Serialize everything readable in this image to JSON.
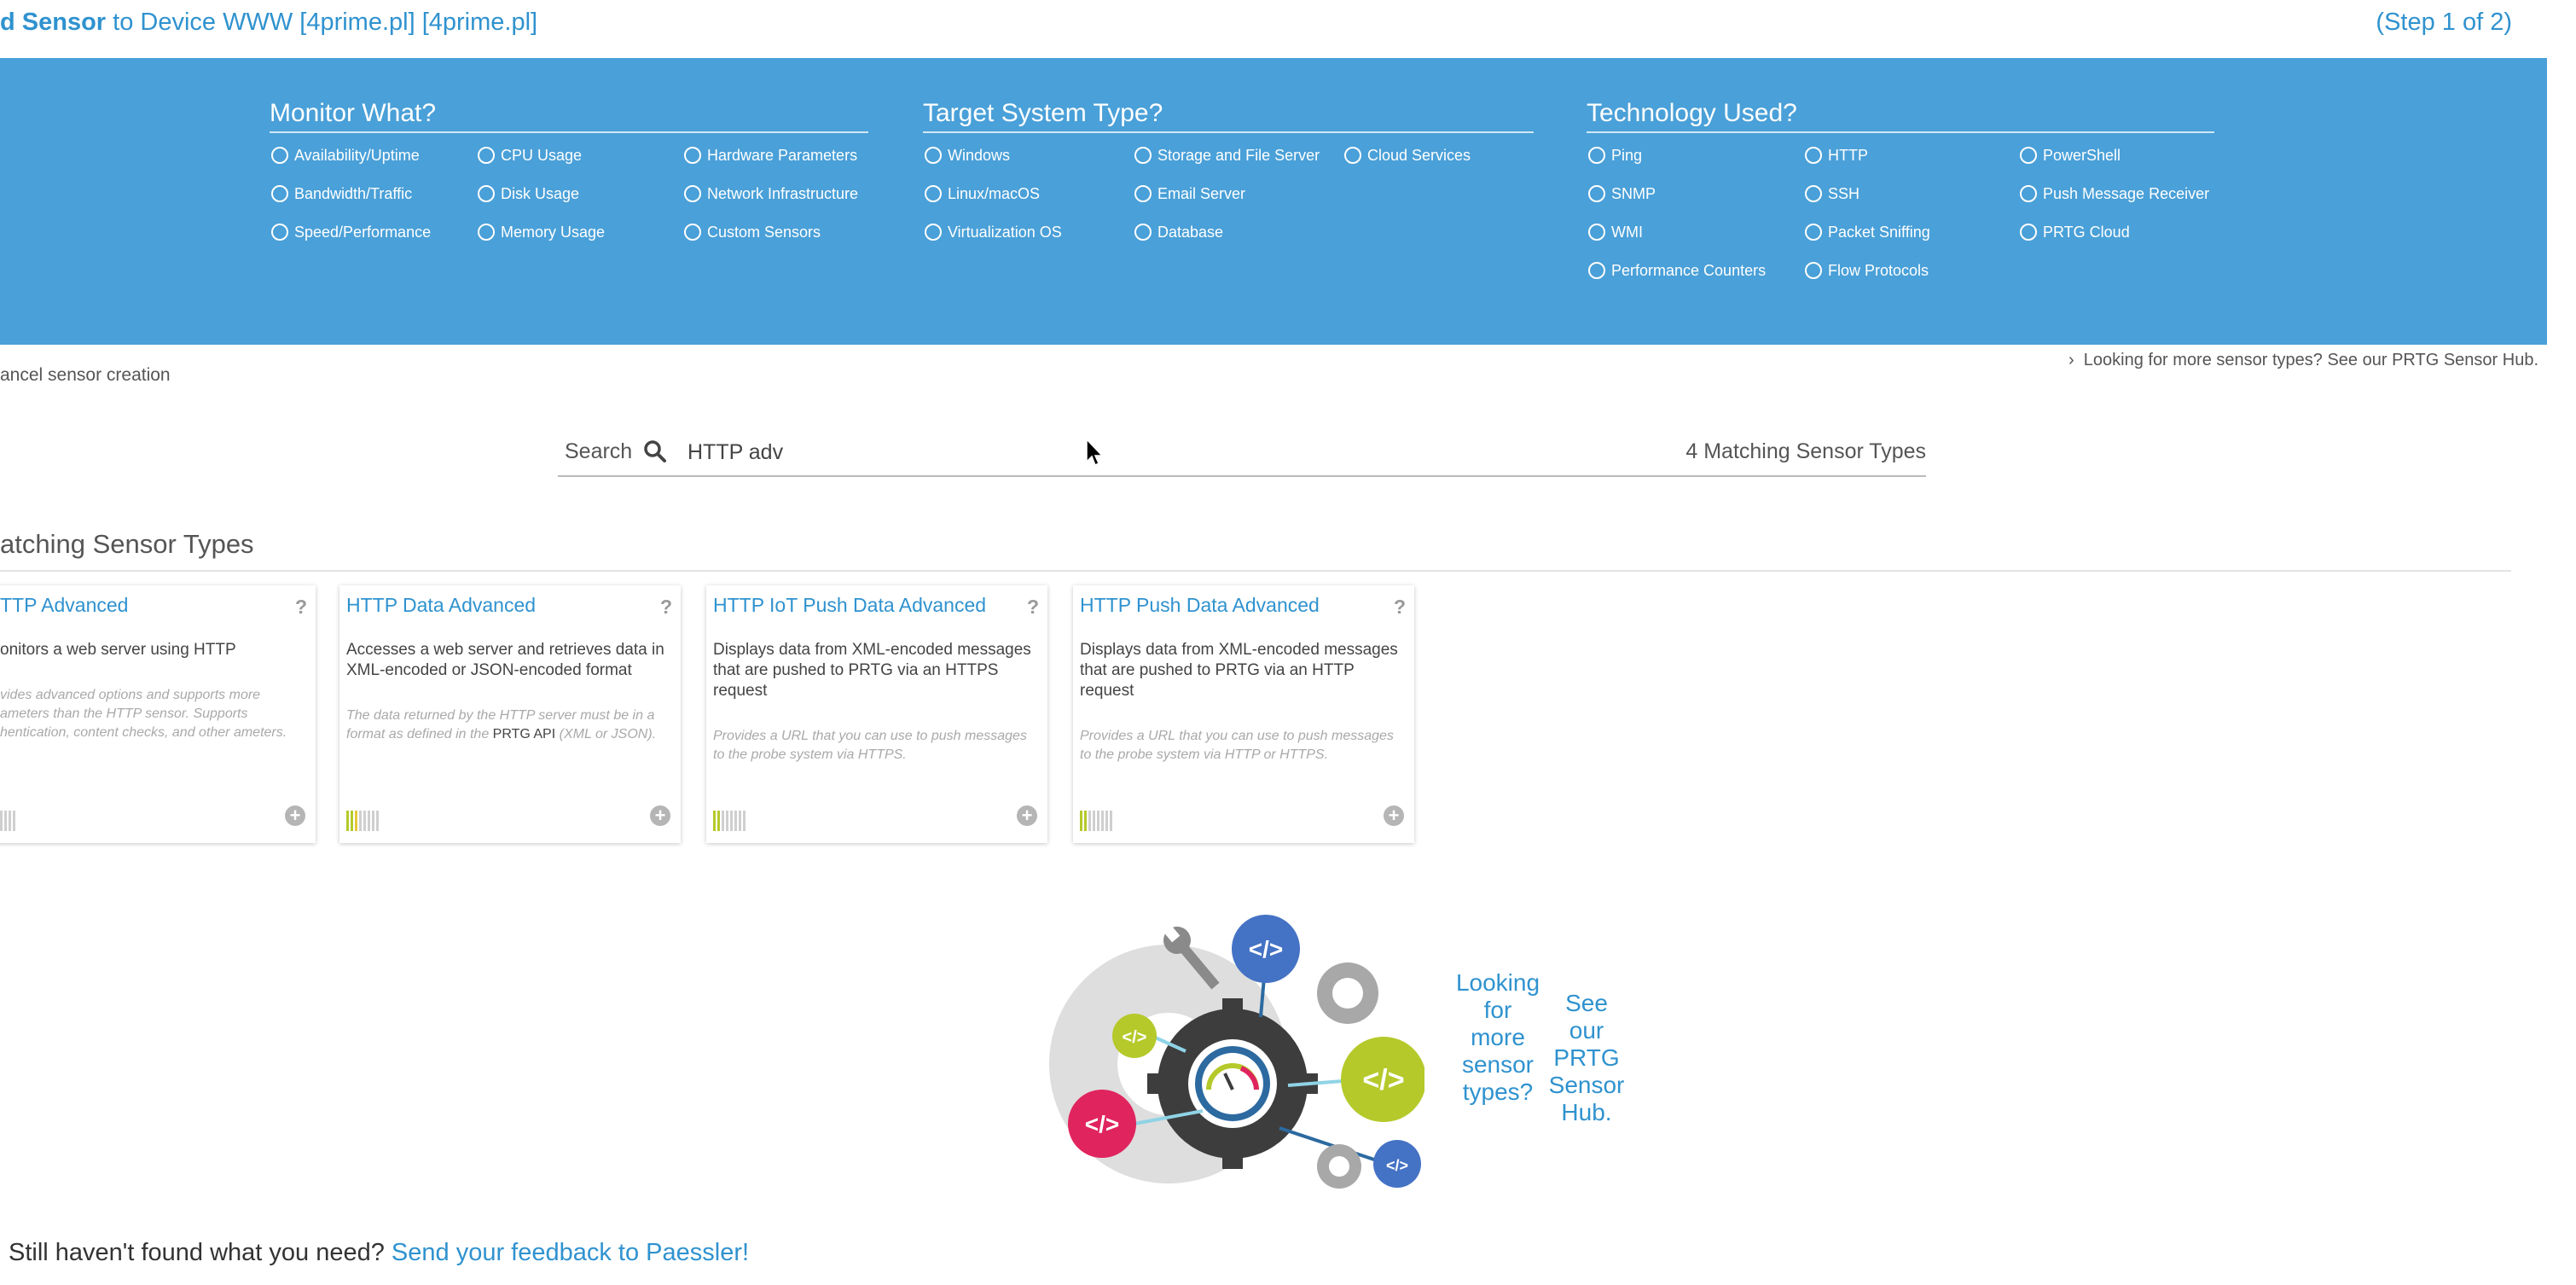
{
  "header": {
    "title_bold": "d Sensor",
    "title_rest": " to Device WWW [4prime.pl] [4prime.pl]",
    "step": "(Step 1 of 2)"
  },
  "filters": {
    "monitor": {
      "title": "Monitor What?",
      "options": [
        "Availability/Uptime",
        "Bandwidth/Traffic",
        "Speed/Performance",
        "CPU Usage",
        "Disk Usage",
        "Memory Usage",
        "Hardware Parameters",
        "Network Infrastructure",
        "Custom Sensors"
      ]
    },
    "target": {
      "title": "Target System Type?",
      "options": [
        "Windows",
        "Linux/macOS",
        "Virtualization OS",
        "Storage and File Server",
        "Email Server",
        "Database",
        "Cloud Services"
      ]
    },
    "technology": {
      "title": "Technology Used?",
      "options": [
        "Ping",
        "SNMP",
        "WMI",
        "Performance Counters",
        "HTTP",
        "SSH",
        "Packet Sniffing",
        "Flow Protocols",
        "PowerShell",
        "Push Message Receiver",
        "PRTG Cloud"
      ]
    }
  },
  "cancel_link": "ancel sensor creation",
  "hub_link": "Looking for more sensor types? See our PRTG Sensor Hub.",
  "search": {
    "label": "Search",
    "value": "HTTP adv",
    "match_count": "4  Matching Sensor Types"
  },
  "section_title": "atching Sensor Types",
  "cards": [
    {
      "title": "TTP Advanced",
      "help": "?",
      "desc": "onitors a web server using HTTP",
      "note": "vides advanced options and supports more ameters than the HTTP sensor. Supports hentication, content checks, and other ameters."
    },
    {
      "title": "HTTP Data Advanced",
      "help": "?",
      "desc": "Accesses a web server and retrieves data in XML-encoded or JSON-encoded format",
      "note_pre": "The data returned by the HTTP server must be in a format as defined in the ",
      "note_link": "PRTG API",
      "note_post": " (XML or JSON)."
    },
    {
      "title": "HTTP IoT Push Data Advanced",
      "help": "?",
      "desc": "Displays data from XML-encoded messages that are pushed to PRTG via an HTTPS request",
      "note": "Provides a URL that you can use to push messages to the probe system via HTTPS."
    },
    {
      "title": "HTTP Push Data Advanced",
      "help": "?",
      "desc": "Displays data from XML-encoded messages that are pushed to PRTG via an HTTP request",
      "note": "Provides a URL that you can use to push messages to the probe system via HTTP or HTTPS."
    }
  ],
  "hub_promo": {
    "left_lines": [
      "Looking",
      "for",
      "more",
      "sensor",
      "types?"
    ],
    "right_lines": [
      "See",
      "our",
      "PRTG",
      "Sensor",
      "Hub."
    ],
    "code_glyph": "</>"
  },
  "feedback": {
    "text": "Still haven't found what you need?",
    "link": "Send your feedback to Paessler!"
  },
  "colors": {
    "band": "#4aa0d8",
    "accent": "#2f92cf",
    "code_blue": "#4472c4",
    "code_green": "#b5c92a",
    "code_red": "#e0245e"
  }
}
